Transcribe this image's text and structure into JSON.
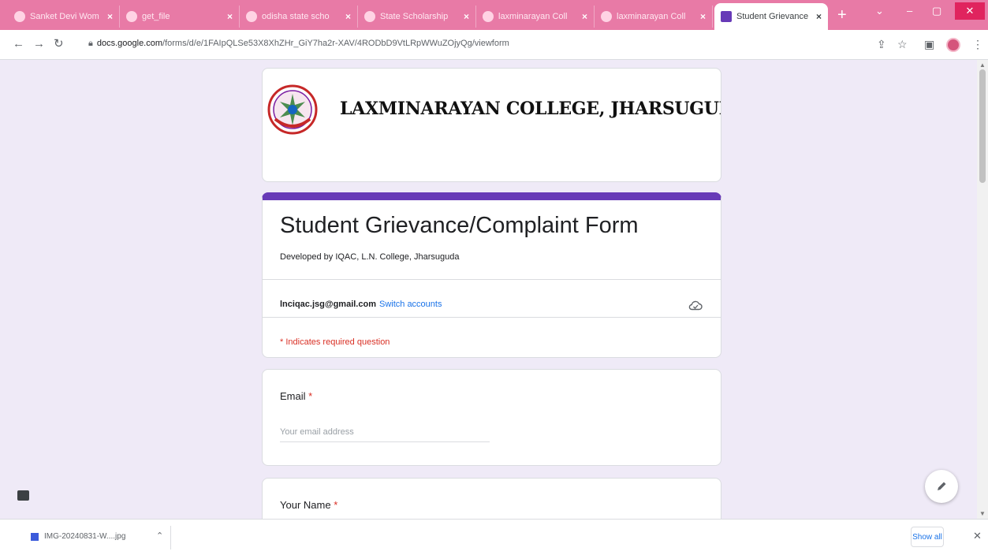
{
  "browser": {
    "tabs": [
      {
        "label": "Sanket Devi Wom",
        "active": false
      },
      {
        "label": "get_file",
        "active": false
      },
      {
        "label": "odisha state scho",
        "active": false
      },
      {
        "label": "State Scholarship",
        "active": false
      },
      {
        "label": "laxminarayan Coll",
        "active": false
      },
      {
        "label": "laxminarayan Coll",
        "active": false
      },
      {
        "label": "Student Grievance",
        "active": true
      }
    ],
    "url_host": "docs.google.com",
    "url_path": "/forms/d/e/1FAIpQLSe53X8XhZHr_GiY7ha2r-XAV/4RODbD9VtLRpWWuZOjyQg/viewform",
    "window_controls": {
      "minimize": "–",
      "maximize": "▢",
      "close": "✕"
    }
  },
  "form": {
    "college_name": "LAXMINARAYAN COLLEGE, JHARSUGUDA",
    "title": "Student Grievance/Complaint Form",
    "description": "Developed by IQAC, L.N. College, Jharsuguda",
    "account_email": "lnciqac.jsg@gmail.com",
    "switch_accounts": "Switch accounts",
    "required_note": "* Indicates required question",
    "questions": [
      {
        "label": "Email",
        "required_mark": "*",
        "placeholder": "Your email address"
      },
      {
        "label": "Your Name",
        "required_mark": "*"
      }
    ]
  },
  "downloads": {
    "file_name": "IMG-20240831-W....jpg",
    "show_all": "Show all"
  },
  "colors": {
    "tab_bar": "#e87aa6",
    "form_accent": "#673ab7",
    "page_bg": "#efeaf7",
    "required_red": "#d93025",
    "link_blue": "#1a73e8"
  },
  "icons": [
    "back-arrow-icon",
    "forward-arrow-icon",
    "reload-icon",
    "lock-icon",
    "share-icon",
    "star-icon",
    "side-panel-icon",
    "cloud-icon",
    "pencil-icon",
    "feedback-icon",
    "file-icon"
  ]
}
